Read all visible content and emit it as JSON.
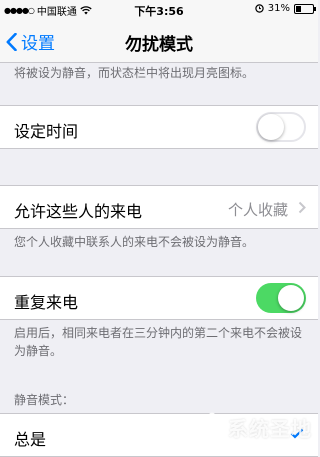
{
  "status_bar": {
    "carrier": "中国联通",
    "time": "下午3:56",
    "battery": "31%",
    "battery_level": 0.31
  },
  "nav": {
    "back_label": "设置",
    "title": "勿扰模式"
  },
  "top_note": "将被设为静音，而状态栏中将出现月亮图标。",
  "scheduled": {
    "label": "设定时间",
    "on": false
  },
  "allow_calls": {
    "label": "允许这些人的来电",
    "value": "个人收藏",
    "note": "您个人收藏中联系人的来电不会被设为静音。"
  },
  "repeated_calls": {
    "label": "重复来电",
    "on": true,
    "note": "启用后，相同来电者在三分钟内的第二个来电不会被设为静音。"
  },
  "silence": {
    "header": "静音模式：",
    "option_label": "总是",
    "selected": true
  },
  "watermark": "系统圣地",
  "colors": {
    "accent": "#007aff",
    "switch_on": "#4cd964"
  }
}
